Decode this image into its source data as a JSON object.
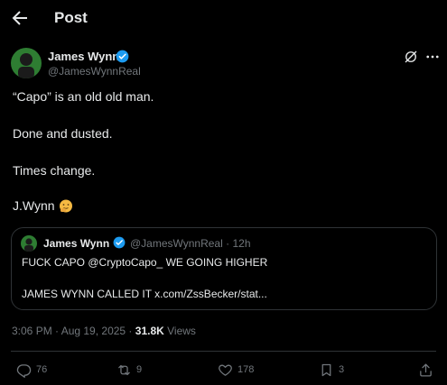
{
  "header": {
    "title": "Post"
  },
  "author": {
    "name": "James Wynn",
    "handle": "@JamesWynnReal"
  },
  "post": {
    "paragraphs": [
      "“Capo” is an old old man.",
      "Done and dusted.",
      "Times change.",
      "J.Wynn"
    ]
  },
  "quote": {
    "name": "James Wynn",
    "handle": "@JamesWynnReal",
    "separator": "·",
    "age": "12h",
    "line1": "FUCK CAPO @CryptoCapo_ WE GOING HIGHER",
    "line2": "JAMES WYNN CALLED IT x.com/ZssBecker/stat..."
  },
  "meta": {
    "time": "3:06 PM · Aug 19, 2025 · ",
    "views_count": "31.8K",
    "views_label": " Views"
  },
  "actions": {
    "replies": "76",
    "reposts": "9",
    "likes": "178",
    "bookmarks": "3"
  },
  "colors": {
    "background": "#000000",
    "text": "#e7e9ea",
    "muted": "#71767b",
    "verified": "#1d9bf0",
    "border": "#2f3336"
  },
  "icons": [
    "back-arrow-icon",
    "verified-icon",
    "grok-icon",
    "more-icon",
    "reply-icon",
    "repost-icon",
    "like-icon",
    "bookmark-icon",
    "share-icon",
    "emoji-icon"
  ]
}
